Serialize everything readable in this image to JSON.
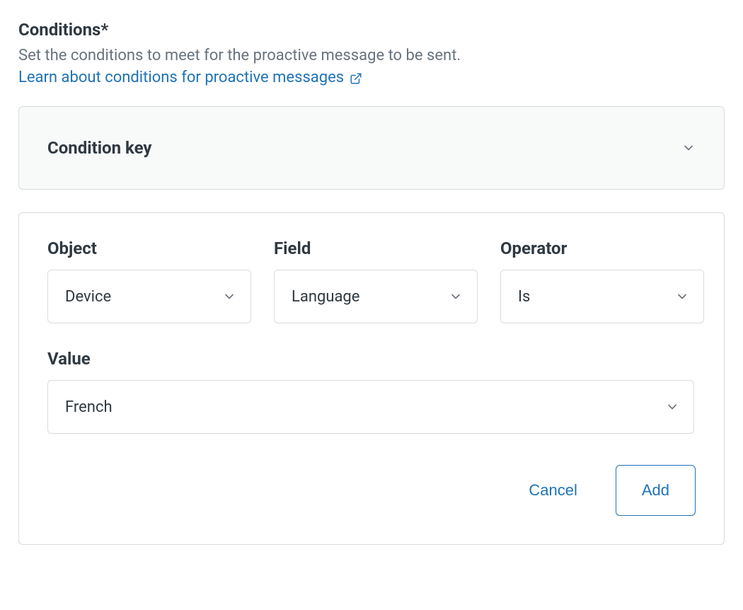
{
  "section": {
    "title": "Conditions*",
    "description": "Set the conditions to meet for the proactive message to be sent.",
    "learn_link": "Learn about conditions for proactive messages"
  },
  "condition_key": {
    "label": "Condition key"
  },
  "form": {
    "object_label": "Object",
    "object_value": "Device",
    "field_label": "Field",
    "field_value": "Language",
    "operator_label": "Operator",
    "operator_value": "Is",
    "value_label": "Value",
    "value_value": "French"
  },
  "actions": {
    "cancel": "Cancel",
    "add": "Add"
  }
}
